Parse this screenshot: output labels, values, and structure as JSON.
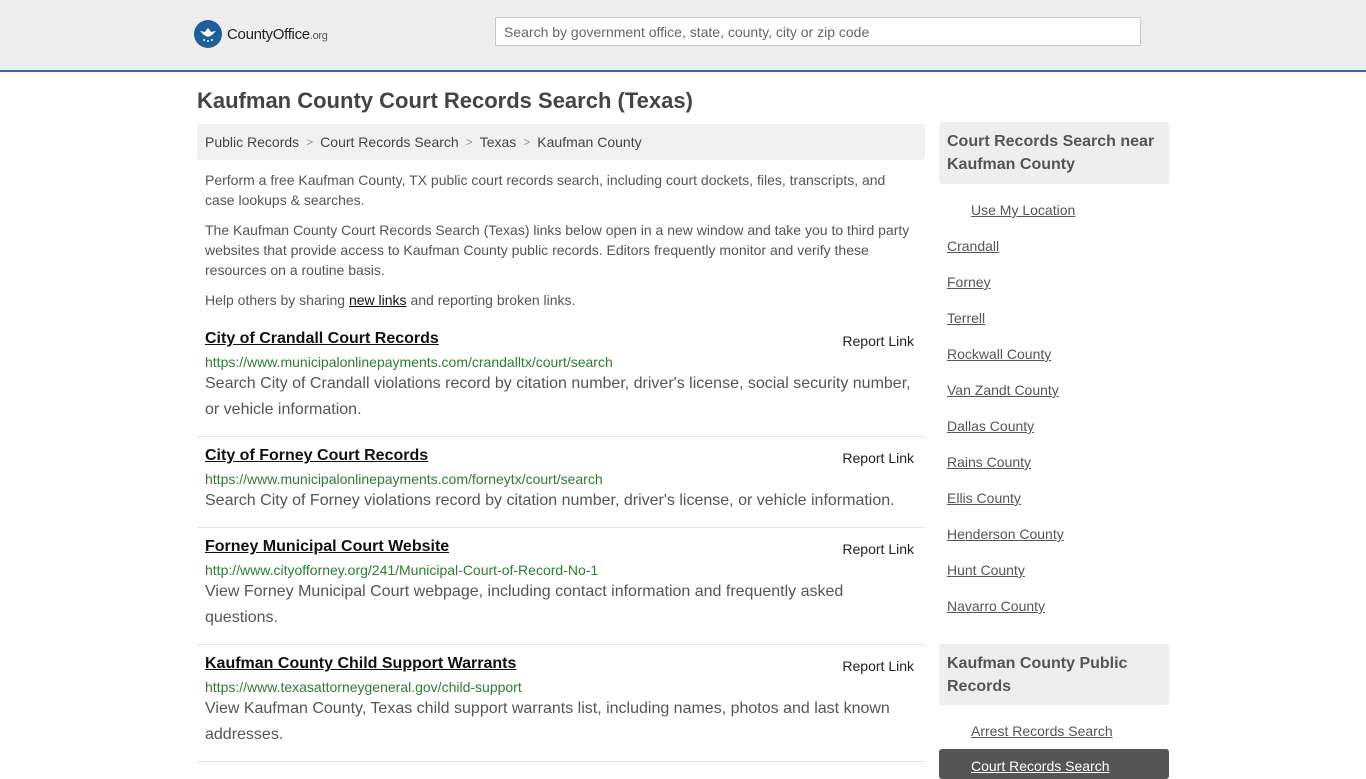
{
  "header": {
    "logo_main": "CountyOffice",
    "logo_suffix": ".org",
    "search_placeholder": "Search by government office, state, county, city or zip code"
  },
  "page_title": "Kaufman County Court Records Search (Texas)",
  "breadcrumb": [
    "Public Records",
    "Court Records Search",
    "Texas",
    "Kaufman County"
  ],
  "intro": {
    "p1": "Perform a free Kaufman County, TX public court records search, including court dockets, files, transcripts, and case lookups & searches.",
    "p2": "The Kaufman County Court Records Search (Texas) links below open in a new window and take you to third party websites that provide access to Kaufman County public records. Editors frequently monitor and verify these resources on a routine basis.",
    "p3_before": "Help others by sharing ",
    "p3_link": "new links",
    "p3_after": " and reporting broken links."
  },
  "report_label": "Report Link",
  "listings": [
    {
      "title": "City of Crandall Court Records",
      "url": "https://www.municipalonlinepayments.com/crandalltx/court/search",
      "description": "Search City of Crandall violations record by citation number, driver's license, social security number, or vehicle information."
    },
    {
      "title": "City of Forney Court Records",
      "url": "https://www.municipalonlinepayments.com/forneytx/court/search",
      "description": "Search City of Forney violations record by citation number, driver's license, or vehicle information."
    },
    {
      "title": "Forney Municipal Court Website",
      "url": "http://www.cityofforney.org/241/Municipal-Court-of-Record-No-1",
      "description": "View Forney Municipal Court webpage, including contact information and frequently asked questions."
    },
    {
      "title": "Kaufman County Child Support Warrants",
      "url": "https://www.texasattorneygeneral.gov/child-support",
      "description": "View Kaufman County, Texas child support warrants list, including names, photos and last known addresses."
    }
  ],
  "sidebar": {
    "nearby_title": "Court Records Search near Kaufman County",
    "use_location": "Use My Location",
    "nearby": [
      "Crandall",
      "Forney",
      "Terrell",
      "Rockwall County",
      "Van Zandt County",
      "Dallas County",
      "Rains County",
      "Ellis County",
      "Henderson County",
      "Hunt County",
      "Navarro County"
    ],
    "public_title": "Kaufman County Public Records",
    "public_links": [
      "Arrest Records Search",
      "Court Records Search"
    ]
  }
}
